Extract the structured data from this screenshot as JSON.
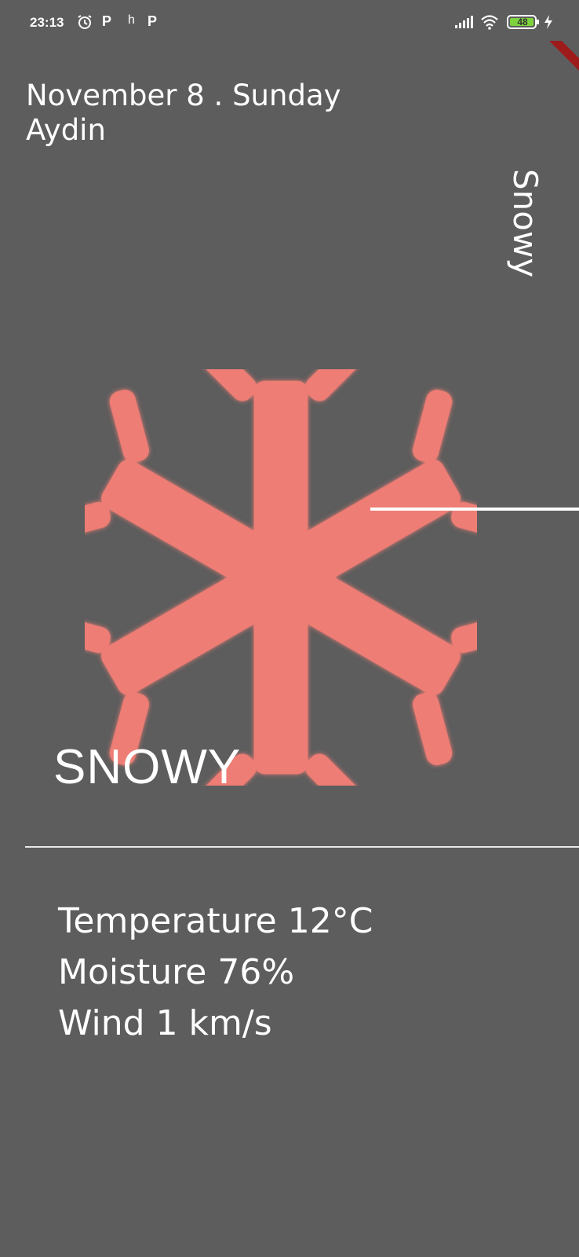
{
  "status_bar": {
    "time": "23:13",
    "notif_1": "P",
    "notif_2": "h",
    "notif_3": "P",
    "battery": "48"
  },
  "header": {
    "date": "November 8 . Sunday",
    "city": "Aydin"
  },
  "side_label": "Snowy",
  "weather": {
    "icon": "snowflake-icon",
    "icon_color": "#ee7d75",
    "condition": "SNOWY"
  },
  "stats": {
    "temperature": "Temperature 12°C",
    "moisture": "Moisture 76%",
    "wind": "Wind 1 km/s"
  },
  "colors": {
    "background": "#5d5d5d",
    "text": "#ffffff",
    "accent": "#ee7d75"
  }
}
